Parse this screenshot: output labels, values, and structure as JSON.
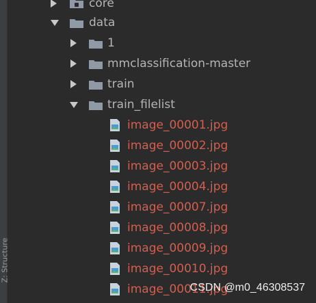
{
  "side_tab": {
    "label": "Z: Structure"
  },
  "tree": {
    "core": "core",
    "data": "data",
    "folder_1": "1",
    "mmcls": "mmclassification-master",
    "train": "train",
    "train_filelist": "train_filelist",
    "files": [
      "image_00001.jpg",
      "image_00002.jpg",
      "image_00003.jpg",
      "image_00004.jpg",
      "image_00007.jpg",
      "image_00008.jpg",
      "image_00009.jpg",
      "image_00010.jpg",
      "image_00011.jpg"
    ]
  },
  "watermark": "CSDN @m0_46308537",
  "colors": {
    "background": "#2b2b2b",
    "folder": "#8f9aa6",
    "file_text": "#d25f4f",
    "text": "#b5b5b5"
  },
  "icons": {
    "folder": "folder-icon",
    "module_folder": "module-folder-icon",
    "image_file": "image-file-icon",
    "expand": "chevron-right-icon",
    "collapse": "chevron-down-icon"
  }
}
